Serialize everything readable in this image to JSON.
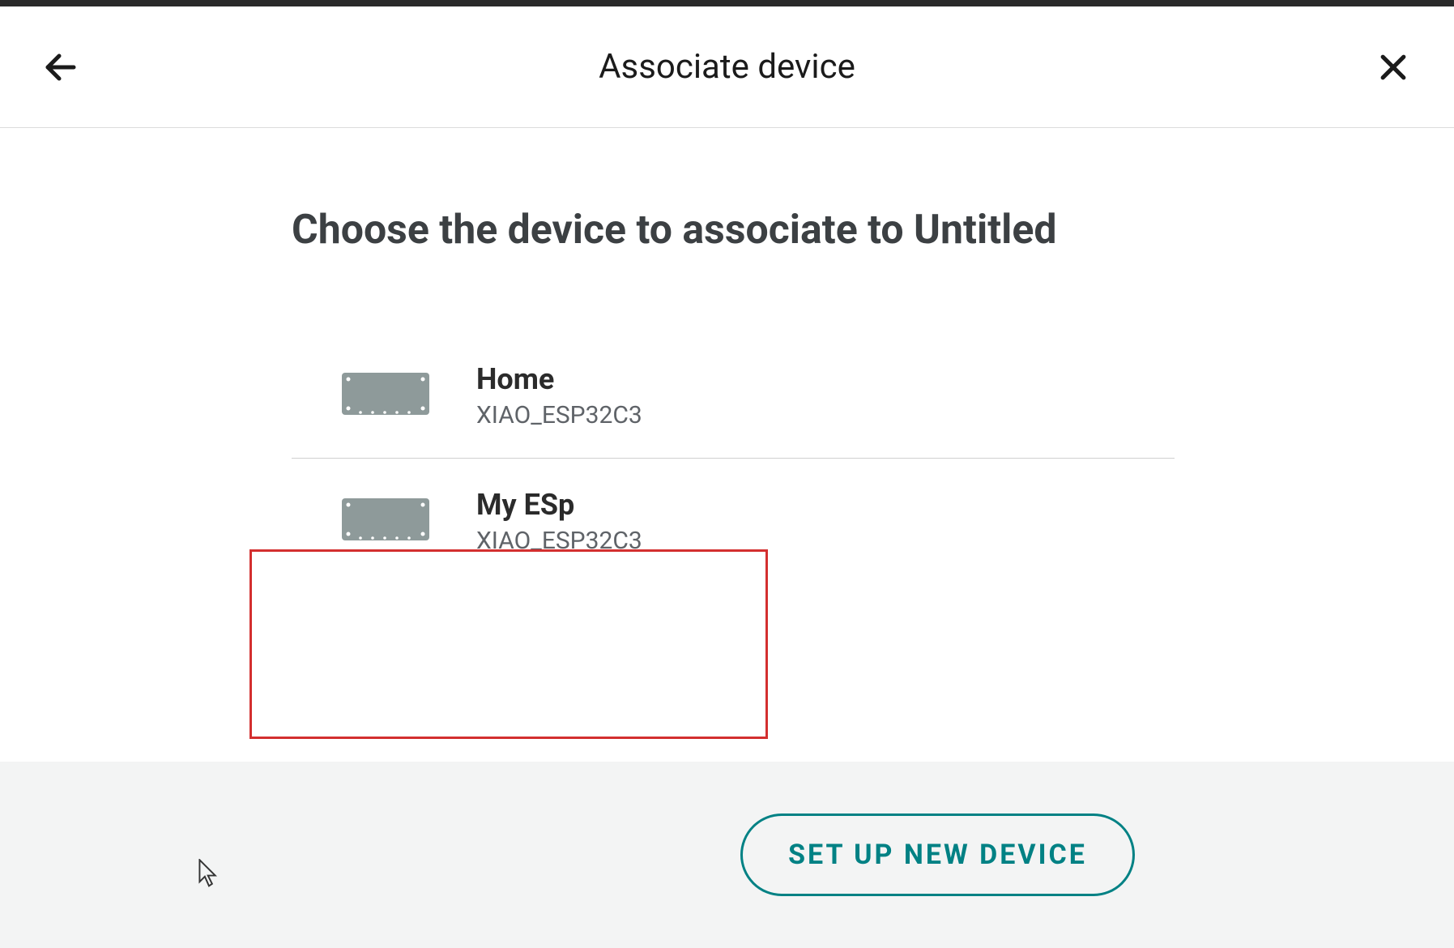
{
  "header": {
    "title": "Associate device"
  },
  "heading": "Choose the device to associate to Untitled",
  "devices": [
    {
      "name": "Home",
      "model": "XIAO_ESP32C3"
    },
    {
      "name": "My ESp",
      "model": "XIAO_ESP32C3"
    }
  ],
  "footer": {
    "setup_button_label": "SET UP NEW DEVICE"
  },
  "colors": {
    "accent": "#008184",
    "highlight_border": "#d32f2f"
  }
}
